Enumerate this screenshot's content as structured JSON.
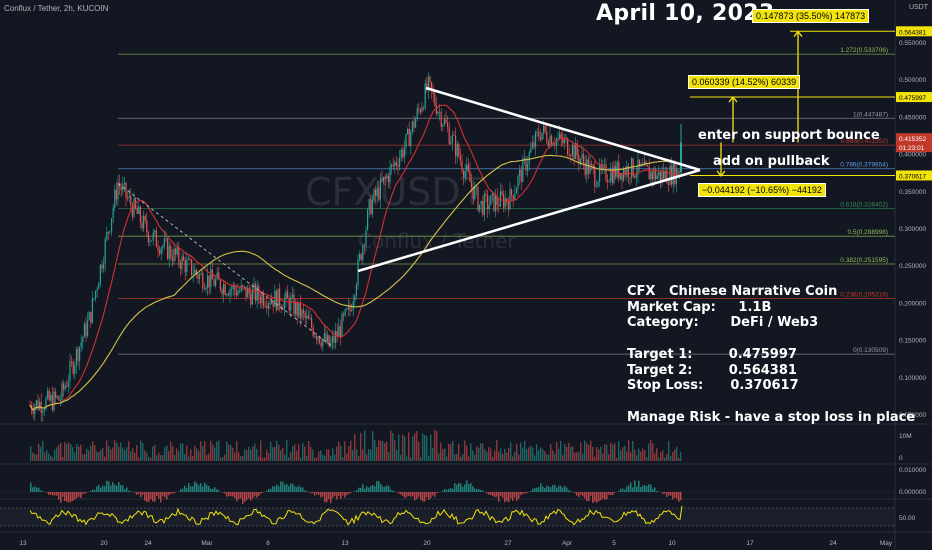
{
  "header": {
    "title": "Conflux / Tether, 2h, KUCOIN",
    "currency": "USDT"
  },
  "date_label": "April  10, 2023",
  "watermark": {
    "symbol": "CFXUSDT",
    "name": "Conflux / Tether"
  },
  "callouts": {
    "top": "0.147873 (35.50%) 147873",
    "mid": "0.060339 (14.52%) 60339",
    "low": "−0.044192 (−10.65%) −44192"
  },
  "notes": {
    "support": "enter on support bounce",
    "pullback": "add on pullback"
  },
  "info": {
    "line1": "CFX   Chinese Narrative Coin",
    "line2": "Market Cap:     1.1B",
    "line3": "Category:       DeFi / Web3",
    "line4": "",
    "line5": "Target 1:        0.475997",
    "line6": "Target 2:        0.564381",
    "line7": "Stop Loss:      0.370617",
    "line8": "",
    "line9": "Manage Risk - have a stop loss in place"
  },
  "fib_levels": [
    {
      "label": "1.272(0.533706)",
      "color": "#8fbc5a",
      "price": 0.533706
    },
    {
      "label": "1(0.447487)",
      "color": "#9598a1",
      "price": 0.447487
    },
    {
      "label": "0.886(0.411352)",
      "color": "#c0392b",
      "price": 0.411352
    },
    {
      "label": "0.786(0.379654)",
      "color": "#5aa0e6",
      "price": 0.379654
    },
    {
      "label": "0.618(0.326402)",
      "color": "#2e8b57",
      "price": 0.326402
    },
    {
      "label": "0.5(0.288998)",
      "color": "#8fbc5a",
      "price": 0.288998
    },
    {
      "label": "0.382(0.251595)",
      "color": "#8fbc5a",
      "price": 0.251595
    },
    {
      "label": "0.236(0.205316)",
      "color": "#c0392b",
      "price": 0.205316
    },
    {
      "label": "0(0.130509)",
      "color": "#9598a1",
      "price": 0.130509
    }
  ],
  "price_axis": {
    "ticks": [
      "0.550000",
      "0.500000",
      "0.450000",
      "0.400000",
      "0.350000",
      "0.300000",
      "0.250000",
      "0.200000",
      "0.150000",
      "0.100000",
      "0.050000"
    ],
    "boxes": [
      {
        "label": "0.564381",
        "bg": "#f2e30a",
        "fg": "#000"
      },
      {
        "label": "0.475997",
        "bg": "#f2e30a",
        "fg": "#000"
      },
      {
        "label": "0.415352",
        "bg": "#c0392b",
        "fg": "#fff"
      },
      {
        "label": "01:23:01",
        "bg": "#c0392b",
        "fg": "#fff"
      },
      {
        "label": "0.370617",
        "bg": "#f2e30a",
        "fg": "#000"
      }
    ],
    "volume_tick": "10M",
    "volume_zero": "0",
    "macd_ticks": [
      "0.010000",
      "0.000000"
    ],
    "rsi_tick": "50.00"
  },
  "time_axis": [
    "13",
    "20",
    "24",
    "Mar",
    "6",
    "13",
    "20",
    "27",
    "Apr",
    "5",
    "10",
    "17",
    "24",
    "May"
  ],
  "colors": {
    "bg": "#131722",
    "up": "#26a69a",
    "down": "#ef5350",
    "ma_red": "#d32f2f",
    "ma_yellow": "#d4c24a",
    "trend": "#ffffff",
    "rsi": "#f2e30a"
  }
}
